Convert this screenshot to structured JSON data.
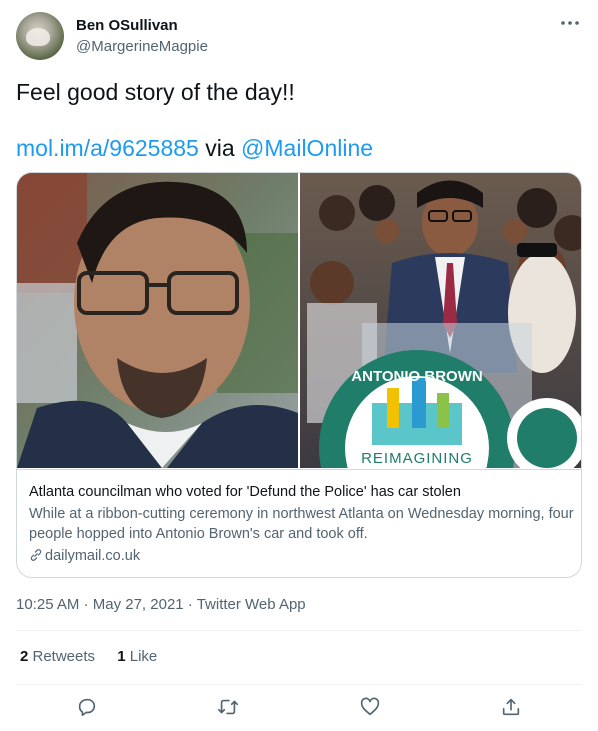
{
  "user": {
    "display_name": "Ben OSullivan",
    "handle": "@MargerineMagpie",
    "avatar_icon": "avatar-photo"
  },
  "menu_icon": "more-icon",
  "tweet": {
    "text": "Feel good story of the day!!",
    "link_text": "mol.im/a/9625885",
    "via_text": " via ",
    "mention": "@MailOnline"
  },
  "card": {
    "title": "Atlanta councilman who voted for 'Defund the Police' has car stolen",
    "description": "While at a ribbon-cutting ceremony in northwest Atlanta on Wednesday morning, four people hopped into Antonio Brown's car and took off.",
    "domain": "dailymail.co.uk",
    "image": {
      "sign_top": "ANTONIO BROWN",
      "sign_bottom": "REIMAGINING"
    }
  },
  "meta": {
    "time": "10:25 AM",
    "sep1": " · ",
    "date": "May 27, 2021",
    "sep2": " · ",
    "source": "Twitter Web App"
  },
  "stats": {
    "retweets_count": "2",
    "retweets_label": " Retweets",
    "likes_count": "1",
    "likes_label": " Like"
  },
  "actions": [
    "reply-icon",
    "retweet-icon",
    "like-icon",
    "share-icon"
  ],
  "colors": {
    "accent": "#1d9bf0",
    "secondary_text": "#536471",
    "border": "#cfd9de"
  }
}
